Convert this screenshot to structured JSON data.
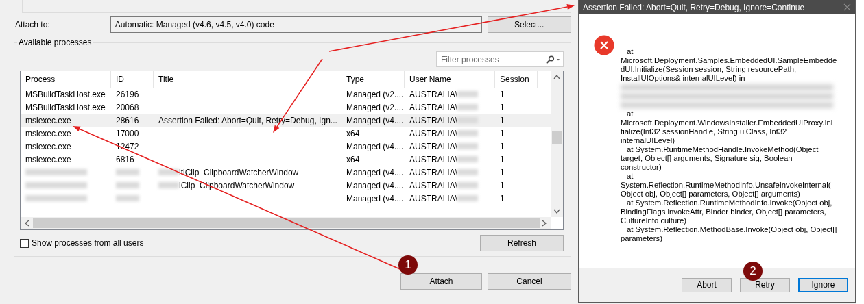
{
  "attach_dialog": {
    "attach_to_label": "Attach to:",
    "attach_to_value": "Automatic: Managed (v4.6, v4.5, v4.0) code",
    "select_button": "Select...",
    "group_title": "Available processes",
    "filter": {
      "placeholder": "Filter processes"
    },
    "columns": [
      "Process",
      "ID",
      "Title",
      "Type",
      "User Name",
      "Session"
    ],
    "rows": [
      {
        "process": "MSBuildTaskHost.exe",
        "id": "26196",
        "title": "",
        "type": "Managed (v2....",
        "user": "AUSTRALIA\\",
        "session": "1",
        "selected": false,
        "blurred": false
      },
      {
        "process": "MSBuildTaskHost.exe",
        "id": "20068",
        "title": "",
        "type": "Managed (v2....",
        "user": "AUSTRALIA\\",
        "session": "1",
        "selected": false,
        "blurred": false
      },
      {
        "process": "msiexec.exe",
        "id": "28616",
        "title": "Assertion Failed: Abort=Quit, Retry=Debug, Ign...",
        "type": "Managed (v4....",
        "user": "AUSTRALIA\\",
        "session": "1",
        "selected": true,
        "blurred": false
      },
      {
        "process": "msiexec.exe",
        "id": "17000",
        "title": "",
        "type": "x64",
        "user": "AUSTRALIA\\",
        "session": "1",
        "selected": false,
        "blurred": false
      },
      {
        "process": "msiexec.exe",
        "id": "12472",
        "title": "",
        "type": "Managed (v4....",
        "user": "AUSTRALIA\\",
        "session": "1",
        "selected": false,
        "blurred": false
      },
      {
        "process": "msiexec.exe",
        "id": "6816",
        "title": "",
        "type": "x64",
        "user": "AUSTRALIA\\",
        "session": "1",
        "selected": false,
        "blurred": false
      },
      {
        "process": "",
        "id": "",
        "title": "ltiClip_ClipboardWatcherWindow",
        "type": "Managed (v4....",
        "user": "AUSTRALIA\\",
        "session": "1",
        "selected": false,
        "blurred": true
      },
      {
        "process": "",
        "id": "",
        "title": "iClip_ClipboardWatcherWindow",
        "type": "Managed (v4....",
        "user": "AUSTRALIA\\",
        "session": "1",
        "selected": false,
        "blurred": true
      },
      {
        "process": "",
        "id": "",
        "title": "",
        "type": "Managed (v4....",
        "user": "AUSTRALIA\\",
        "session": "1",
        "selected": false,
        "blurred": true
      }
    ],
    "show_all_users": {
      "label": "Show processes from all users",
      "checked": false
    },
    "refresh_button": "Refresh",
    "attach_button": "Attach",
    "cancel_button": "Cancel"
  },
  "assert_dialog": {
    "title": "Assertion Failed: Abort=Quit, Retry=Debug, Ignore=Continue",
    "message": [
      {
        "kind": "text",
        "text": "at",
        "indented": true
      },
      {
        "kind": "text",
        "text": "Microsoft.Deployment.Samples.EmbeddedUI.SampleEmbedde",
        "indented": false
      },
      {
        "kind": "text",
        "text": "dUI.Initialize(Session session, String resourcePath,",
        "indented": false
      },
      {
        "kind": "text",
        "text": "InstallUIOptions& internalUILevel) in",
        "indented": false
      },
      {
        "kind": "blur"
      },
      {
        "kind": "blur"
      },
      {
        "kind": "blur"
      },
      {
        "kind": "text",
        "text": "at",
        "indented": true
      },
      {
        "kind": "text",
        "text": "Microsoft.Deployment.WindowsInstaller.EmbeddedUIProxy.Ini",
        "indented": false
      },
      {
        "kind": "text",
        "text": "tialize(Int32 sessionHandle, String uiClass, Int32",
        "indented": false
      },
      {
        "kind": "text",
        "text": "internalUILevel)",
        "indented": false
      },
      {
        "kind": "text",
        "text": "at System.RuntimeMethodHandle.InvokeMethod(Object",
        "indented": true
      },
      {
        "kind": "text",
        "text": "target, Object[] arguments, Signature sig, Boolean",
        "indented": false
      },
      {
        "kind": "text",
        "text": "constructor)",
        "indented": false
      },
      {
        "kind": "text",
        "text": "at",
        "indented": true
      },
      {
        "kind": "text",
        "text": "System.Reflection.RuntimeMethodInfo.UnsafeInvokeInternal(",
        "indented": false
      },
      {
        "kind": "text",
        "text": "Object obj, Object[] parameters, Object[] arguments)",
        "indented": false
      },
      {
        "kind": "text",
        "text": "at System.Reflection.RuntimeMethodInfo.Invoke(Object obj,",
        "indented": true
      },
      {
        "kind": "text",
        "text": "BindingFlags invokeAttr, Binder binder, Object[] parameters,",
        "indented": false
      },
      {
        "kind": "text",
        "text": "CultureInfo culture)",
        "indented": false
      },
      {
        "kind": "text",
        "text": "at System.Reflection.MethodBase.Invoke(Object obj, Object[]",
        "indented": true
      },
      {
        "kind": "text",
        "text": "parameters)",
        "indented": false
      }
    ],
    "buttons": [
      {
        "label": "Abort",
        "selected": false
      },
      {
        "label": "Retry",
        "selected": false
      },
      {
        "label": "Ignore",
        "selected": true
      }
    ]
  },
  "annotations": [
    {
      "number": "1"
    },
    {
      "number": "2"
    }
  ]
}
